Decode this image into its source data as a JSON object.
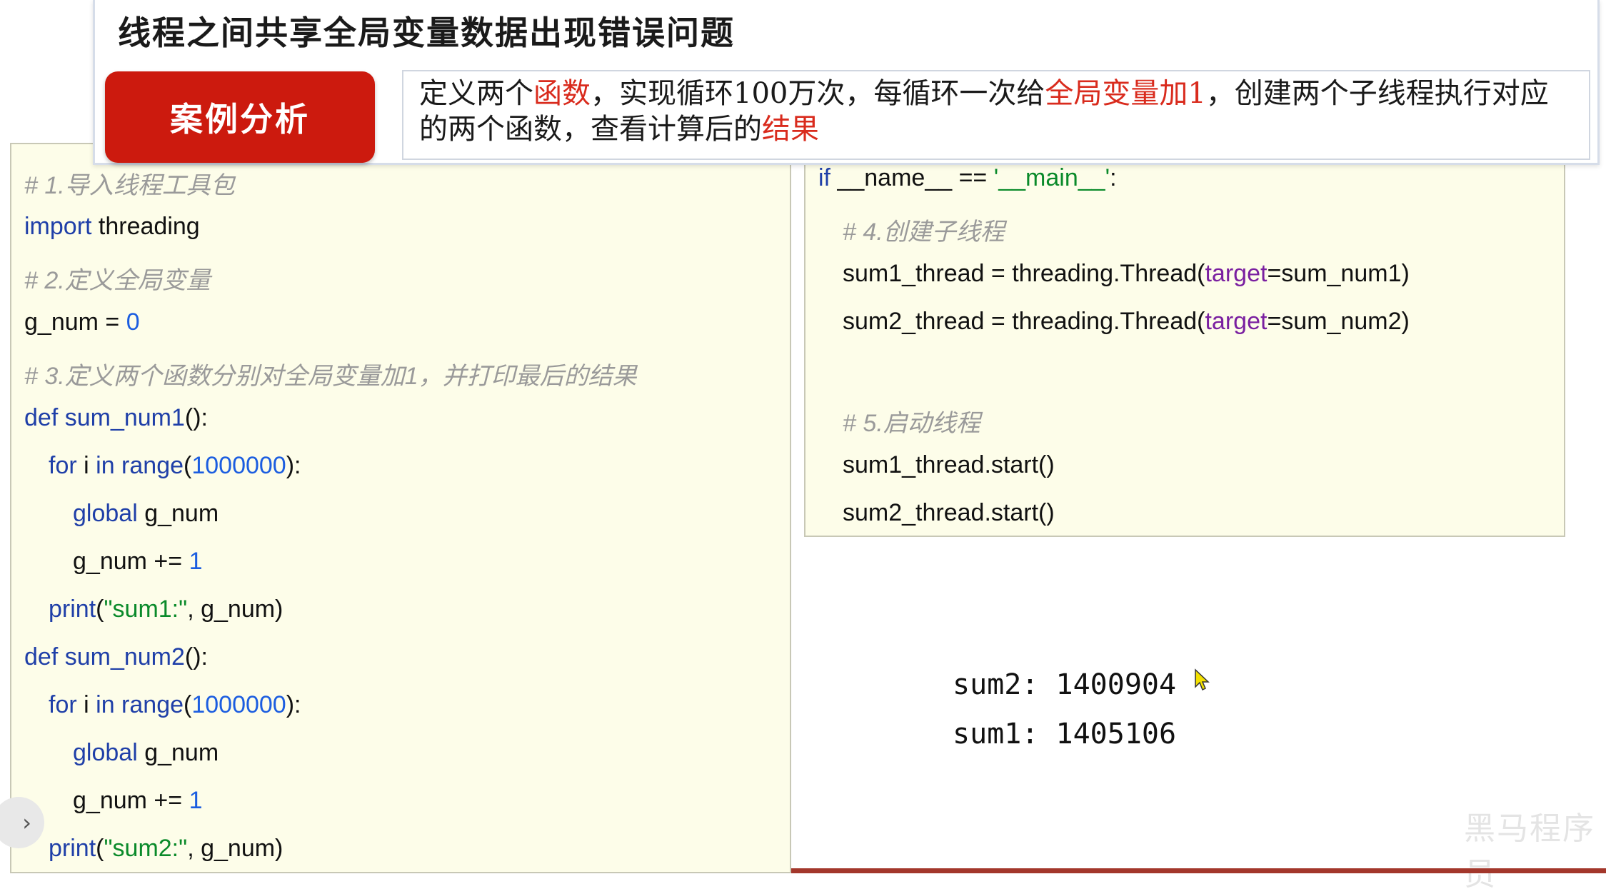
{
  "header": {
    "title": "线程之间共享全局变量数据出现错误问题",
    "case_label": "案例分析",
    "desc": {
      "p1": "定义两个",
      "r1": "函数",
      "p2": "，实现循环100万次，每循环一次给",
      "r2": "全局变量加1",
      "p3": "，创建两个子线程执行对应的两个函数，查看计算后的",
      "r3": "结果"
    }
  },
  "code_left": {
    "c1": "# 1.导入线程工具包",
    "import_kw": "import",
    "import_mod": " threading",
    "c2": "# 2.定义全局变量",
    "gnum_assign": "g_num = ",
    "gnum_val": "0",
    "c3": "# 3.定义两个函数分别对全局变量加1，并打印最后的结果",
    "def1_kw": "def",
    "def1_name": " sum_num1",
    "def_paren": "():",
    "for_kw": "for",
    "for_i": " i ",
    "in_kw": "in",
    "range_kw": " range",
    "paren_open": "(",
    "range_val": "1000000",
    "paren_close_colon": "):",
    "global_kw": "global",
    "global_var": " g_num",
    "inc": "g_num += ",
    "inc_val": "1",
    "print_kw": "print",
    "str1": "\"sum1:\"",
    "print_tail": ", g_num)",
    "def2_kw": "def",
    "def2_name": " sum_num2",
    "str2": "\"sum2:\""
  },
  "code_right": {
    "if_kw": "if",
    "if_cond": " __name__ == ",
    "main_str": "'__main__'",
    "colon": ":",
    "c4": "# 4.创建子线程",
    "t1_pre": "sum1_thread = threading.Thread(",
    "target_kw": "target",
    "t1_post": "=sum_num1)",
    "t2_pre": "sum2_thread = threading.Thread(",
    "t2_post": "=sum_num2)",
    "c5": "# 5.启动线程",
    "s1": "sum1_thread.start()",
    "s2": "sum2_thread.start()"
  },
  "output": {
    "line1": "sum2: 1400904",
    "line2": "sum1: 1405106"
  },
  "ui": {
    "expand_glyph": "›",
    "watermark": "黑马程序员"
  }
}
